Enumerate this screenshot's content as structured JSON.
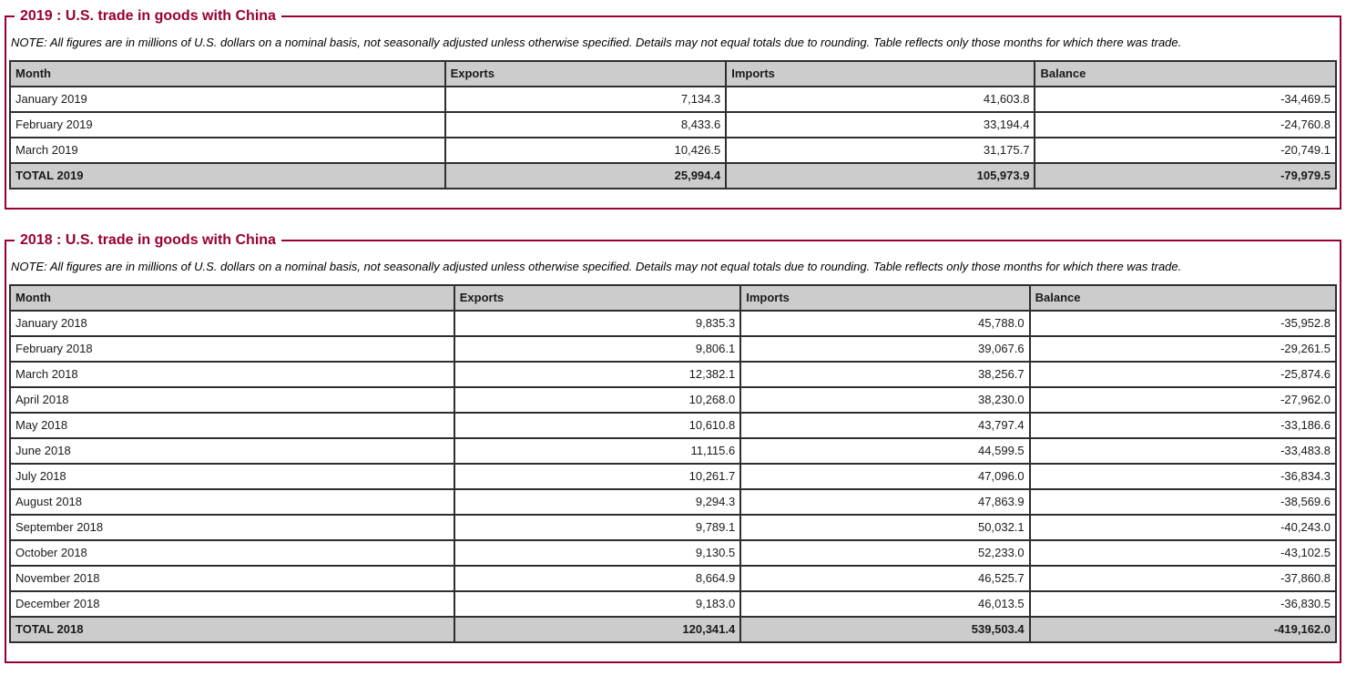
{
  "colors": {
    "accent": "#990033",
    "table_header_bg": "#cccccc",
    "total_row_bg": "#cccccc",
    "table_border": "#2e2e2e",
    "page_bg": "#ffffff"
  },
  "note": "NOTE: All figures are in millions of U.S. dollars on a nominal basis, not seasonally adjusted unless otherwise specified. Details may not equal totals due to rounding. Table reflects only those months for which there was trade.",
  "tables": [
    {
      "legend": "2019 : U.S. trade in goods with China",
      "columns": [
        "Month",
        "Exports",
        "Imports",
        "Balance"
      ],
      "rows": [
        [
          "January 2019",
          "7,134.3",
          "41,603.8",
          "-34,469.5"
        ],
        [
          "February 2019",
          "8,433.6",
          "33,194.4",
          "-24,760.8"
        ],
        [
          "March 2019",
          "10,426.5",
          "31,175.7",
          "-20,749.1"
        ]
      ],
      "total": [
        "TOTAL 2019",
        "25,994.4",
        "105,973.9",
        "-79,979.5"
      ]
    },
    {
      "legend": "2018 : U.S. trade in goods with China",
      "columns": [
        "Month",
        "Exports",
        "Imports",
        "Balance"
      ],
      "rows": [
        [
          "January 2018",
          "9,835.3",
          "45,788.0",
          "-35,952.8"
        ],
        [
          "February 2018",
          "9,806.1",
          "39,067.6",
          "-29,261.5"
        ],
        [
          "March 2018",
          "12,382.1",
          "38,256.7",
          "-25,874.6"
        ],
        [
          "April 2018",
          "10,268.0",
          "38,230.0",
          "-27,962.0"
        ],
        [
          "May 2018",
          "10,610.8",
          "43,797.4",
          "-33,186.6"
        ],
        [
          "June 2018",
          "11,115.6",
          "44,599.5",
          "-33,483.8"
        ],
        [
          "July 2018",
          "10,261.7",
          "47,096.0",
          "-36,834.3"
        ],
        [
          "August 2018",
          "9,294.3",
          "47,863.9",
          "-38,569.6"
        ],
        [
          "September 2018",
          "9,789.1",
          "50,032.1",
          "-40,243.0"
        ],
        [
          "October 2018",
          "9,130.5",
          "52,233.0",
          "-43,102.5"
        ],
        [
          "November 2018",
          "8,664.9",
          "46,525.7",
          "-37,860.8"
        ],
        [
          "December 2018",
          "9,183.0",
          "46,013.5",
          "-36,830.5"
        ]
      ],
      "total": [
        "TOTAL 2018",
        "120,341.4",
        "539,503.4",
        "-419,162.0"
      ]
    }
  ]
}
